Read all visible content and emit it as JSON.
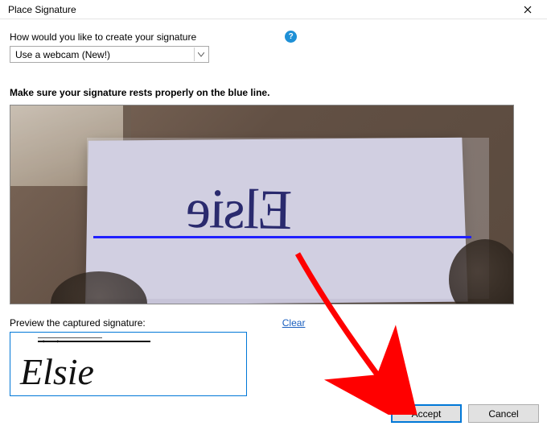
{
  "window": {
    "title": "Place Signature"
  },
  "prompt": {
    "label": "How would you like to create your signature"
  },
  "dropdown": {
    "selected": "Use a webcam (New!)"
  },
  "instruction": "Make sure your signature rests properly on the blue line.",
  "webcam": {
    "signature_text": "Elsie"
  },
  "preview": {
    "label": "Preview the captured signature:",
    "clear": "Clear",
    "signature_text": "Elsie"
  },
  "buttons": {
    "accept": "Accept",
    "cancel": "Cancel"
  }
}
